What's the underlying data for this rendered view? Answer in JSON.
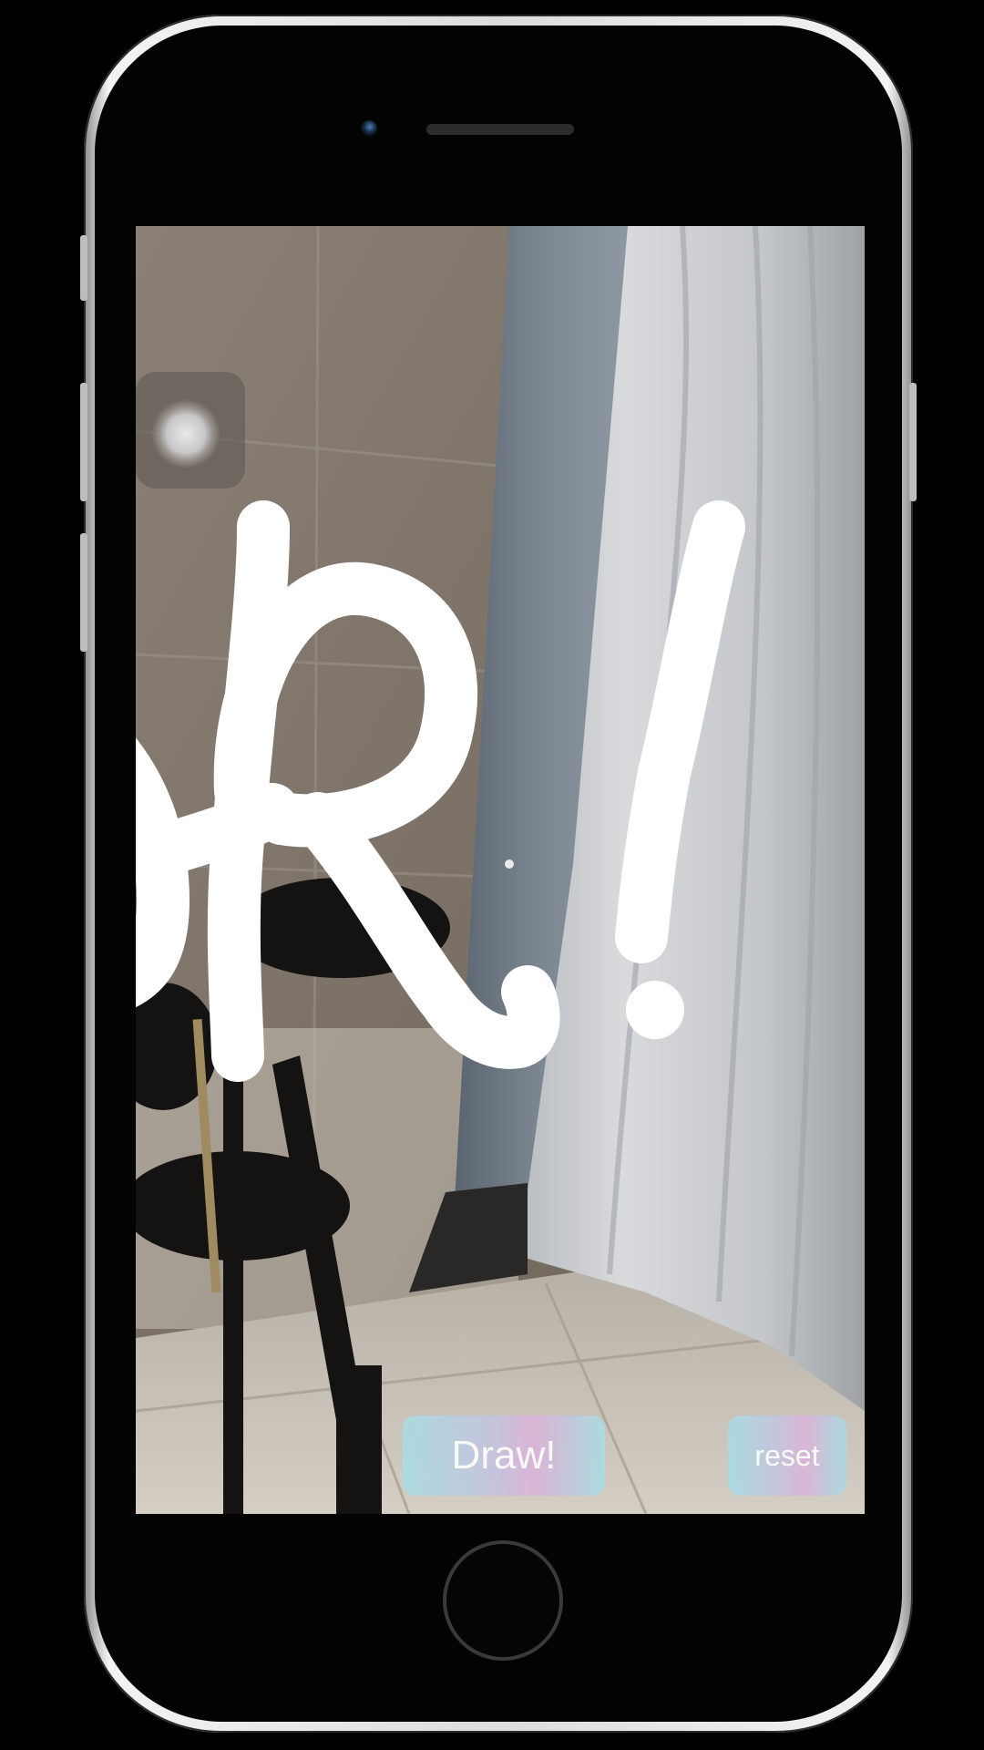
{
  "app": {
    "drawn_text": "R!"
  },
  "controls": {
    "draw_label": "Draw!",
    "reset_label": "reset"
  },
  "icons": {
    "assistive_touch": "assistive-touch-icon",
    "camera": "front-camera-icon"
  },
  "colors": {
    "button_gradient_start": "#a9dce3",
    "button_gradient_mid": "#dcb3d9",
    "stroke": "#ffffff",
    "device_frame": "#e6e6e6"
  }
}
